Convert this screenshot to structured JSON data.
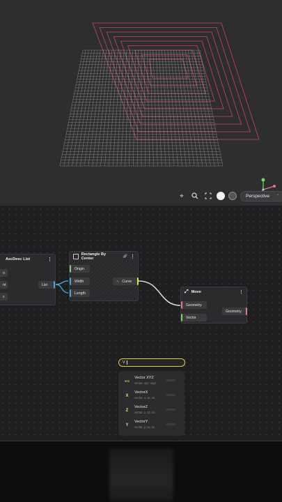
{
  "viewport": {
    "camera_mode": "Perspective",
    "toolbar_icons": [
      "target-icon",
      "search-icon",
      "fullscreen-icon",
      "light-toggle-icon",
      "dark-toggle-icon",
      "settings-icon"
    ]
  },
  "nodes": {
    "ascdesc": {
      "title": "AscDesc List",
      "inputs": [
        "n",
        "nt",
        "c"
      ],
      "output": "List"
    },
    "rectangle": {
      "title": "Rectangle By Center",
      "inputs": [
        "Origin",
        "Width",
        "Length"
      ],
      "output": "Curve"
    },
    "move": {
      "title": "Move",
      "inputs": [
        "Geometry",
        "Vector"
      ],
      "output": "Geometry"
    }
  },
  "search": {
    "query": "V",
    "results": [
      {
        "icon": "XYZ",
        "title": "Vector XYZ",
        "subtitle": "vector, xyz, vxyz"
      },
      {
        "icon": "X",
        "title": "VectorX",
        "subtitle": "vector, x, vx, vx"
      },
      {
        "icon": "Z",
        "title": "VectorZ",
        "subtitle": "vector, z, vz, vz"
      },
      {
        "icon": "Y",
        "title": "VectorY",
        "subtitle": "vector, y, vy, vy"
      }
    ]
  },
  "colors": {
    "accent_yellow": "#e4e24b",
    "port_green": "#7bd46b",
    "port_blue": "#4aa3d6",
    "port_pink": "#e07a93",
    "rect_red": "#d84a5e"
  }
}
